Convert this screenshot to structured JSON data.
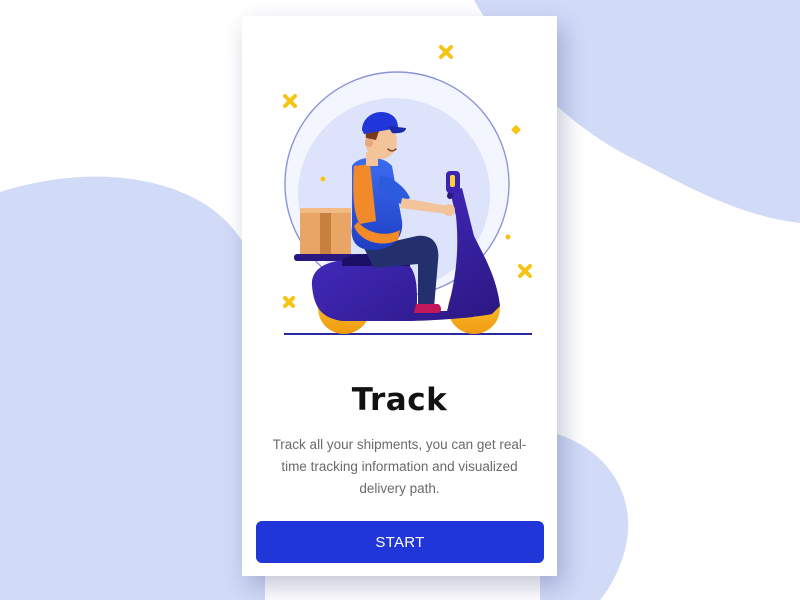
{
  "colors": {
    "background_blob": "#d1daf7",
    "accent": "#2036d8",
    "title": "#121212",
    "description": "#6a6a6a",
    "sparkle": "#f5c414"
  },
  "onboarding": {
    "title": "Track",
    "description": "Track all your shipments, you can get real-time tracking information and visualized delivery path.",
    "start_label": "START",
    "illustration": "delivery-courier-on-scooter"
  }
}
